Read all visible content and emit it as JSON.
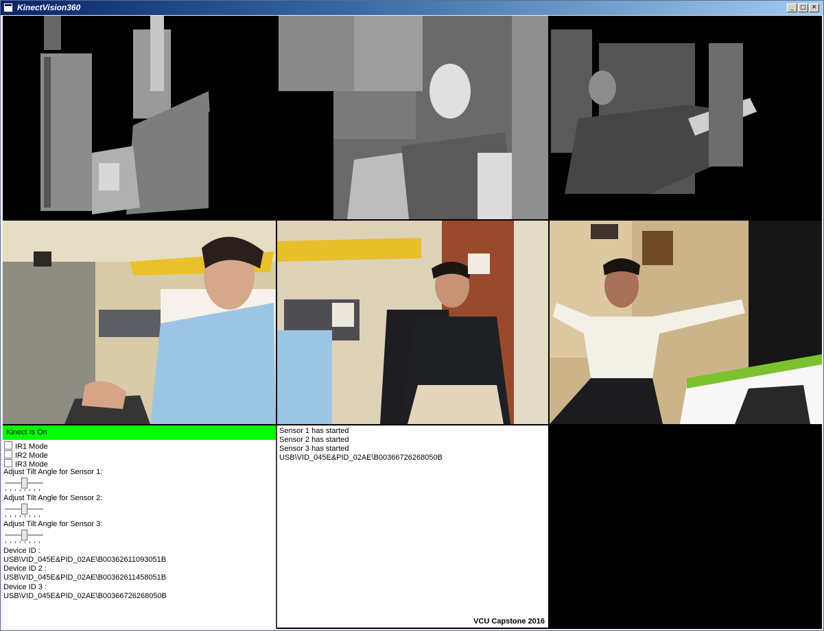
{
  "window": {
    "title": "KinectVision360",
    "controls": [
      "minimize",
      "maximize",
      "close"
    ]
  },
  "depth_feeds": [
    {
      "sensor": 1
    },
    {
      "sensor": 2
    },
    {
      "sensor": 3
    }
  ],
  "color_feeds": [
    {
      "sensor": 1
    },
    {
      "sensor": 2
    },
    {
      "sensor": 3
    }
  ],
  "control_panel": {
    "status": "Kinect Is On",
    "status_color": "#00ff00",
    "ir_modes": [
      {
        "label": "IR1 Mode",
        "checked": false
      },
      {
        "label": "IR2 Mode",
        "checked": false
      },
      {
        "label": "IR3 Mode",
        "checked": false
      }
    ],
    "tilt_sliders": [
      {
        "label": "Adjust Tilt Angle for Sensor 1:",
        "value_fraction": 0.5
      },
      {
        "label": "Adjust Tilt Angle for Sensor 2:",
        "value_fraction": 0.5
      },
      {
        "label": "Adjust Tilt Angle for Sensor 3:",
        "value_fraction": 0.5
      }
    ],
    "devices": [
      {
        "label": "Device ID :",
        "value": "USB\\VID_045E&PID_02AE\\B00362611093051B"
      },
      {
        "label": "Device ID 2 :",
        "value": "USB\\VID_045E&PID_02AE\\B00362611458051B"
      },
      {
        "label": "Device ID 3 :",
        "value": "USB\\VID_045E&PID_02AE\\B00366726268050B"
      }
    ]
  },
  "log_panel": {
    "lines": [
      "Sensor 1 has started",
      "Sensor 2 has started",
      "Sensor 3 has started",
      "USB\\VID_045E&PID_02AE\\B00366726268050B"
    ],
    "credit": "VCU Capstone 2016"
  }
}
